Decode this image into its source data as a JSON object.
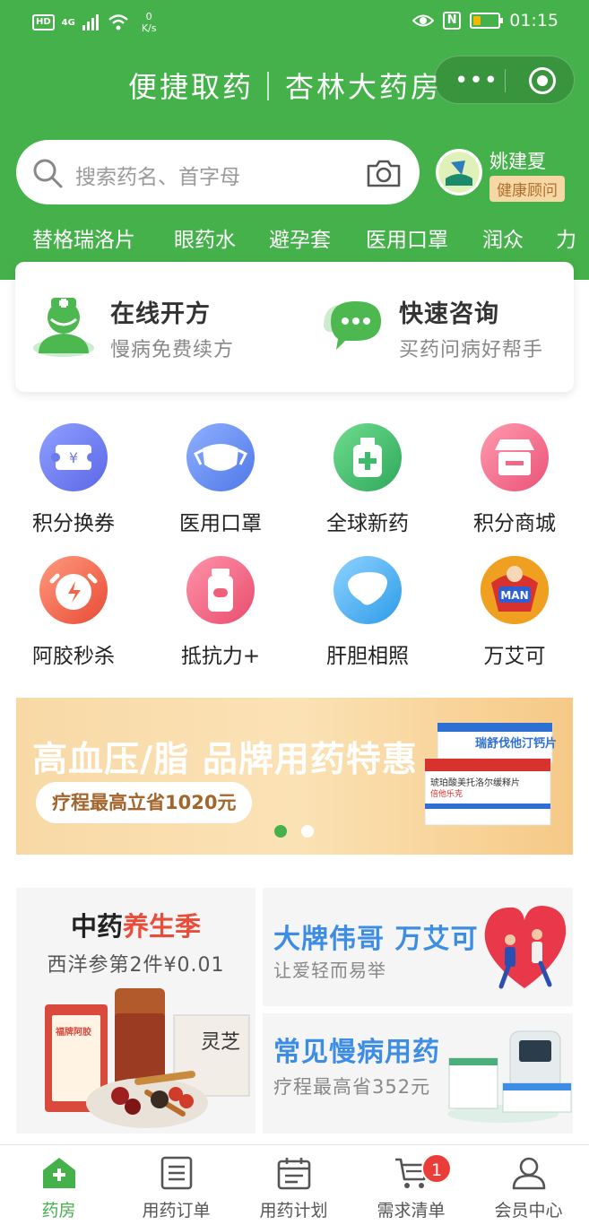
{
  "status_bar": {
    "hd": "HD",
    "network": "4G",
    "speed_value": "0",
    "speed_unit": "K/s",
    "time": "01:15",
    "nfc": "N"
  },
  "nav": {
    "title": "便捷取药｜杏林大药房",
    "more_glyph": "•••"
  },
  "search": {
    "placeholder": "搜索药名、首字母"
  },
  "user": {
    "name": "姚建夏",
    "role": "健康顾问"
  },
  "hot_tags": [
    "替格瑞洛片",
    "眼药水",
    "避孕套",
    "医用口罩",
    "润众",
    "力"
  ],
  "services": [
    {
      "title": "在线开方",
      "subtitle": "慢病免费续方",
      "icon": "doctor-icon"
    },
    {
      "title": "快速咨询",
      "subtitle": "买药问病好帮手",
      "icon": "chat-bubble-icon"
    }
  ],
  "grid": [
    {
      "label": "积分换券",
      "icon": "coupon-icon",
      "color": "#6b7cf0"
    },
    {
      "label": "医用口罩",
      "icon": "mask-icon",
      "color": "#5d86ef"
    },
    {
      "label": "全球新药",
      "icon": "medicine-bottle-icon",
      "color": "#3dbb6a"
    },
    {
      "label": "积分商城",
      "icon": "store-icon",
      "color": "#f06a85"
    },
    {
      "label": "阿胶秒杀",
      "icon": "alarm-clock-icon",
      "color": "#f0644b"
    },
    {
      "label": "抵抗力+",
      "icon": "pill-bottle-icon",
      "color": "#f0607a"
    },
    {
      "label": "肝胆相照",
      "icon": "liver-icon",
      "color": "#3aa7f0"
    },
    {
      "label": "万艾可",
      "icon": "superman-icon",
      "color": "#f0a020"
    }
  ],
  "banner": {
    "title": "高血压/脂 品牌用药特惠",
    "pill": "疗程最高立省1020元",
    "product_label": "瑞舒伐他汀钙片",
    "product_label2": "琥珀酸美托洛尔缓释片",
    "product_brand": "倍他乐克",
    "dots_active": 1,
    "colors": {
      "active_dot": "#45b14a",
      "dot": "#ffffff"
    }
  },
  "promos": {
    "tcm": {
      "title_part1": "中药",
      "title_part2": "养生季",
      "subtitle": "西洋参第2件¥0.01",
      "logo_text": "福牌阿胶",
      "box_text": "灵芝"
    },
    "viagra": {
      "title": "大牌伟哥 万艾可",
      "subtitle": "让爱轻而易举"
    },
    "chronic": {
      "title": "常见慢病用药",
      "subtitle": "疗程最高省352元"
    }
  },
  "tabbar": {
    "items": [
      {
        "label": "药房",
        "icon": "pharmacy-home-icon",
        "active": true
      },
      {
        "label": "用药订单",
        "icon": "order-list-icon",
        "active": false
      },
      {
        "label": "用药计划",
        "icon": "calendar-plan-icon",
        "active": false
      },
      {
        "label": "需求清单",
        "icon": "cart-icon",
        "active": false
      },
      {
        "label": "会员中心",
        "icon": "user-icon",
        "active": false
      }
    ],
    "cart_badge": "1"
  },
  "theme": {
    "primary": "#45b14a",
    "accent": "#e94d3a",
    "link": "#3d8de4"
  }
}
